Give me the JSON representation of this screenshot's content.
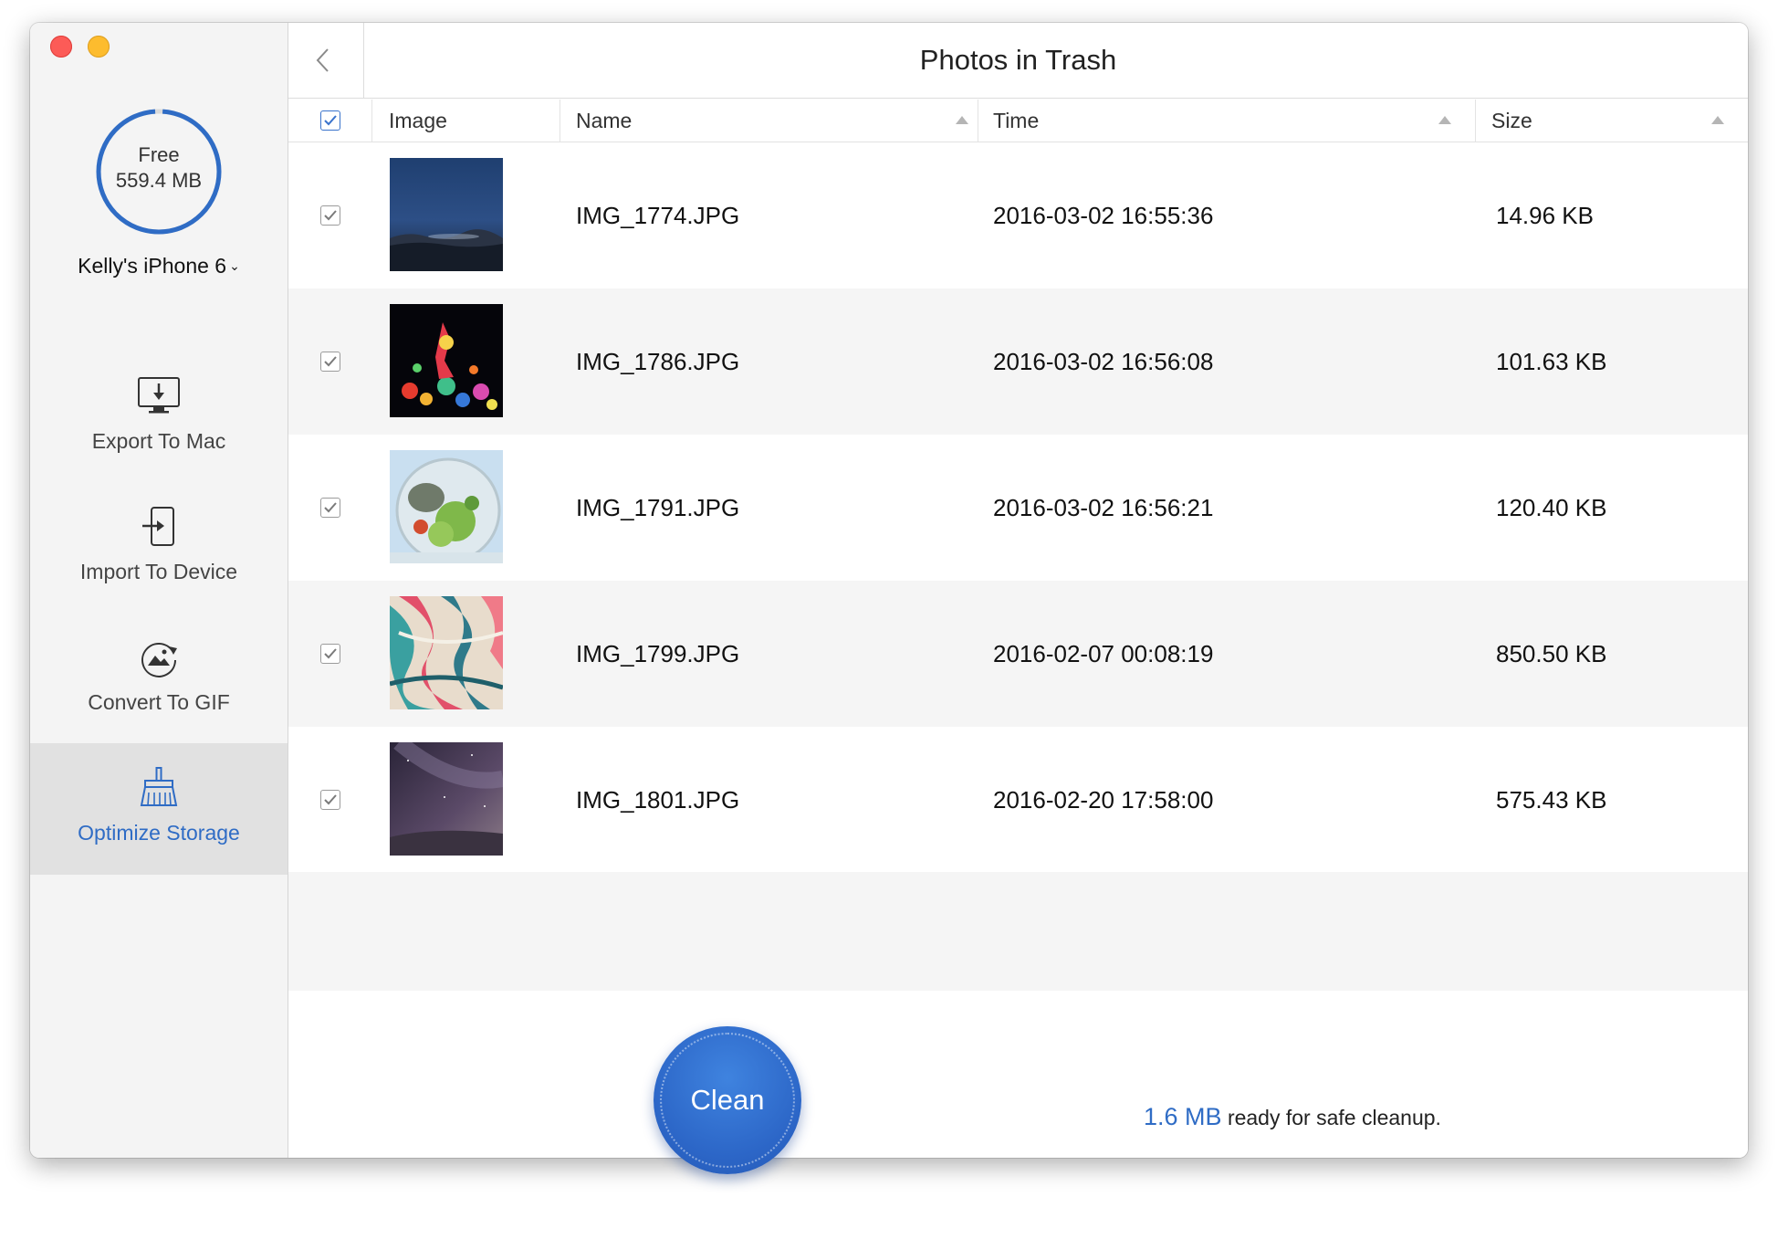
{
  "window": {
    "controls": [
      "close",
      "minimize"
    ]
  },
  "sidebar": {
    "storage": {
      "label": "Free",
      "value": "559.4 MB",
      "used_fraction": 0.98,
      "accent": "#2f6cc5"
    },
    "device": {
      "name": "Kelly's iPhone 6"
    },
    "items": [
      {
        "label": "Export To Mac",
        "icon": "export-to-mac-icon",
        "active": false
      },
      {
        "label": "Import To Device",
        "icon": "import-to-device-icon",
        "active": false
      },
      {
        "label": "Convert To GIF",
        "icon": "convert-to-gif-icon",
        "active": false
      },
      {
        "label": "Optimize Storage",
        "icon": "broom-icon",
        "active": true
      }
    ]
  },
  "header": {
    "title": "Photos in Trash"
  },
  "table": {
    "select_all": true,
    "columns": {
      "image": "Image",
      "name": "Name",
      "time": "Time",
      "size": "Size"
    },
    "rows": [
      {
        "checked": true,
        "name": "IMG_1774.JPG",
        "time": "2016-03-02 16:55:36",
        "size": "14.96 KB"
      },
      {
        "checked": true,
        "name": "IMG_1786.JPG",
        "time": "2016-03-02 16:56:08",
        "size": "101.63 KB"
      },
      {
        "checked": true,
        "name": "IMG_1791.JPG",
        "time": "2016-03-02 16:56:21",
        "size": "120.40 KB"
      },
      {
        "checked": true,
        "name": "IMG_1799.JPG",
        "time": "2016-02-07 00:08:19",
        "size": "850.50 KB"
      },
      {
        "checked": true,
        "name": "IMG_1801.JPG",
        "time": "2016-02-20 17:58:00",
        "size": "575.43 KB"
      }
    ]
  },
  "footer": {
    "clean_label": "Clean",
    "cleanup_size": "1.6 MB",
    "cleanup_text": "ready for safe cleanup."
  },
  "colors": {
    "accent": "#2f6cc5",
    "clean_button": "#2c66c7",
    "active_nav_bg": "#e1e1e1"
  }
}
